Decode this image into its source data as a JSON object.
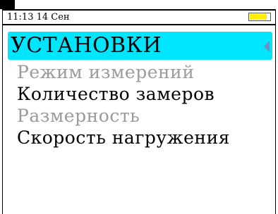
{
  "status": {
    "time": "11:13",
    "date": "14 Сен",
    "battery_level": 0.85,
    "battery_color": "#ffee00"
  },
  "header": {
    "title": "УСТАНОВКИ",
    "arrow_icon": "triangle-left-icon",
    "background": "#00e6ff"
  },
  "menu": {
    "items": [
      {
        "label": "Режим измерений",
        "enabled": false
      },
      {
        "label": "Количество замеров",
        "enabled": true
      },
      {
        "label": "Размерность",
        "enabled": false
      },
      {
        "label": "Скорость нагружения",
        "enabled": true
      }
    ]
  }
}
